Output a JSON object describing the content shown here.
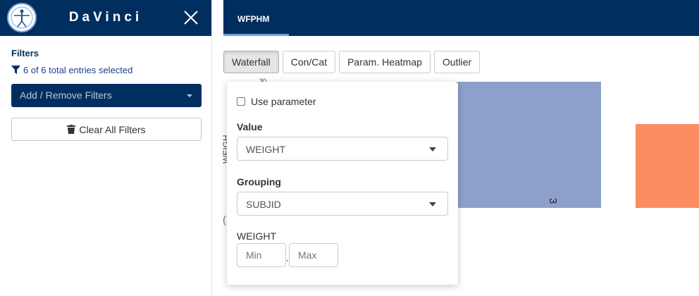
{
  "sidebar": {
    "brand": "DaVinci",
    "filters_title": "Filters",
    "filter_count_text": "6 of 6 total entries selected",
    "add_remove_label": "Add / Remove Filters",
    "clear_all_label": "Clear All Filters"
  },
  "topbar": {
    "active_tab": "WFPHM"
  },
  "plot_tabs": [
    "Waterfall",
    "Con/Cat",
    "Param. Heatmap",
    "Outlier"
  ],
  "active_plot_tab": "Waterfall",
  "popover": {
    "use_parameter_label": "Use parameter",
    "use_parameter_checked": false,
    "value_label": "Value",
    "value_selected": "WEIGHT",
    "grouping_label": "Grouping",
    "grouping_selected": "SUBJID",
    "range_label": "WEIGHT",
    "min_placeholder": "Min",
    "max_placeholder": "Max",
    "range_separator": ","
  },
  "chart": {
    "ylabel_partial": "WEIGH",
    "bar_label": "3",
    "stray_paren": "(",
    "stray_top": "30",
    "colors": {
      "bar1": "#8da0cb",
      "bar2": "#fc8d62"
    }
  },
  "colors": {
    "navy": "#002f5f",
    "tab_underline": "#6f9fe0"
  },
  "icons": {
    "logo": "vitruvian-logo-icon",
    "close": "close-icon",
    "filter": "filter-icon",
    "trash": "trash-icon",
    "dropdown": "caret-down-icon"
  }
}
